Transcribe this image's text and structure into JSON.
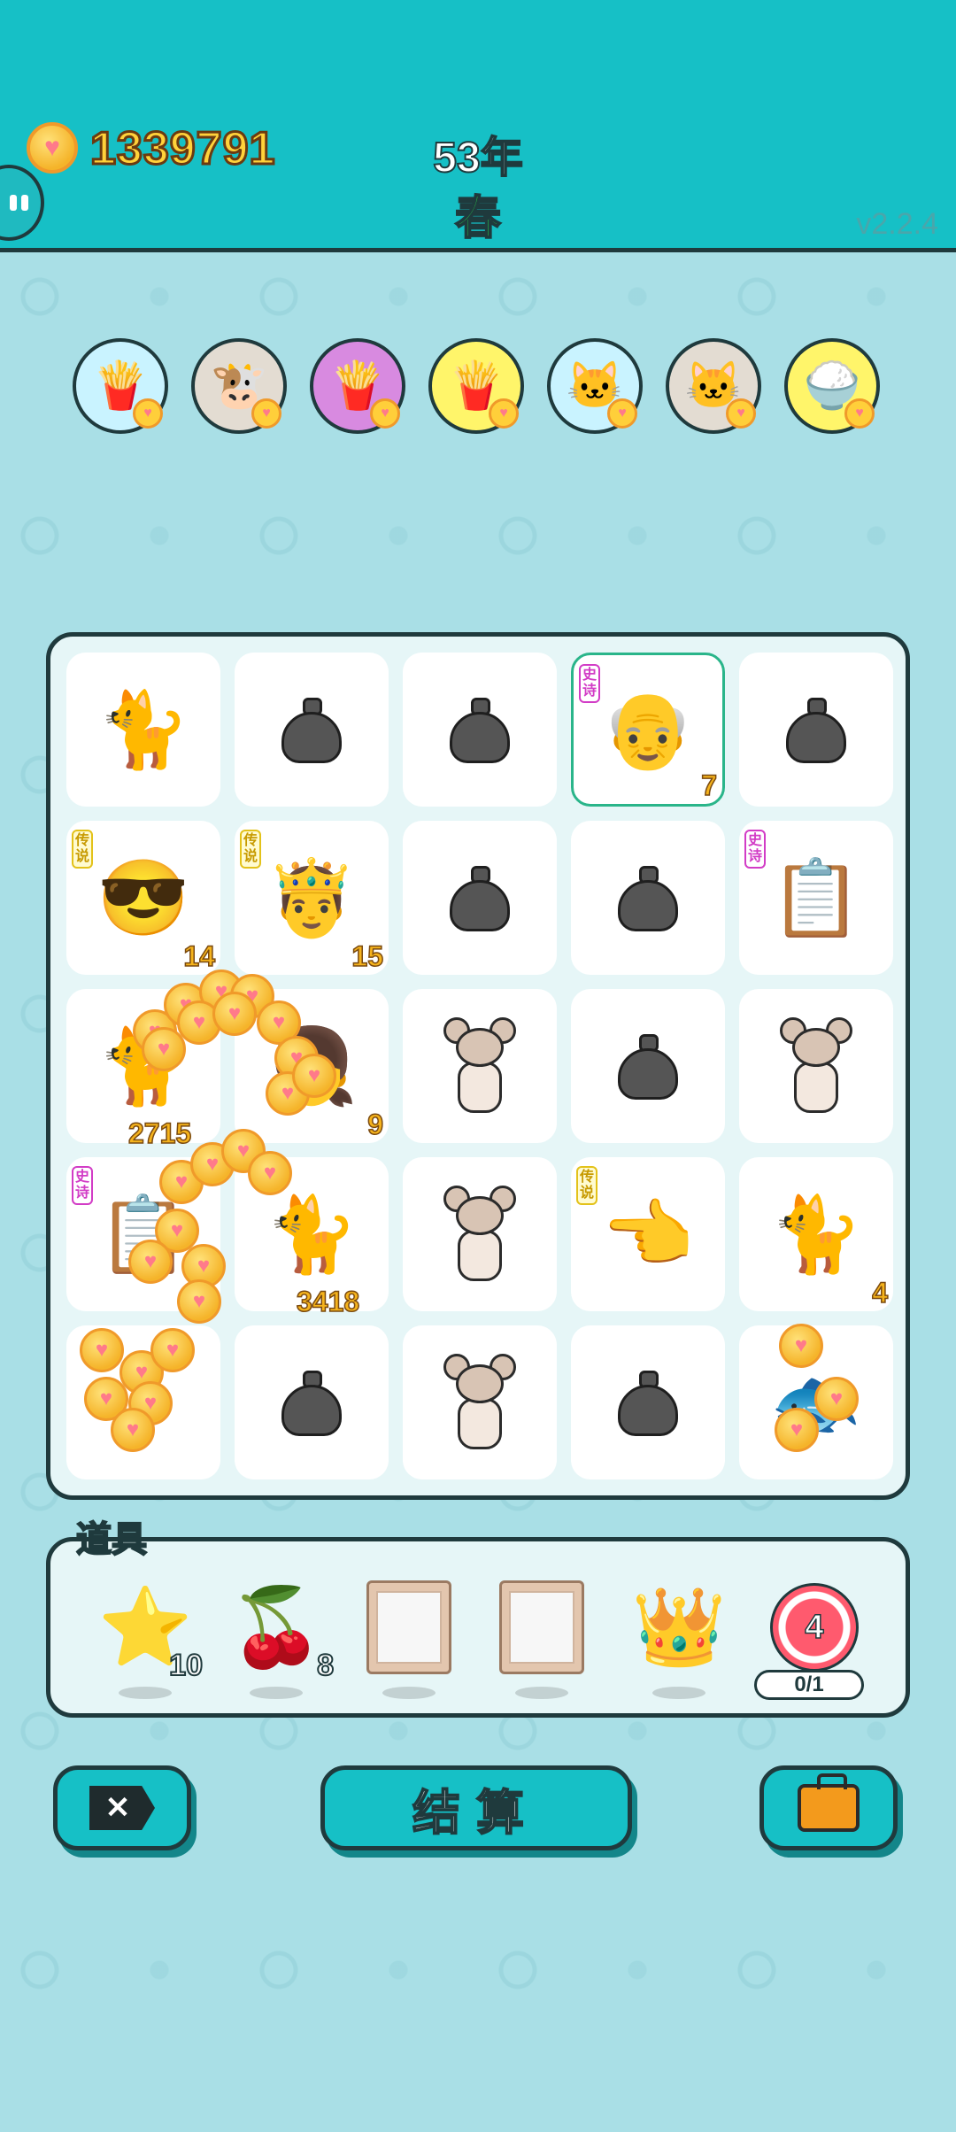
{
  "header": {
    "coins": "1339791",
    "year": "53年",
    "season": "春",
    "version": "v2.2.4"
  },
  "upcoming": [
    {
      "name": "fries",
      "glyph": "🍟",
      "bg": "#c9f3ff"
    },
    {
      "name": "cows",
      "glyph": "🐮",
      "bg": "#e3dcd2"
    },
    {
      "name": "fries",
      "glyph": "🍟",
      "bg": "#d88ae0"
    },
    {
      "name": "fries",
      "glyph": "🍟",
      "bg": "#fff56a"
    },
    {
      "name": "cat",
      "glyph": "🐱",
      "bg": "#c9f3ff"
    },
    {
      "name": "cats",
      "glyph": "🐱",
      "bg": "#e3dcd2"
    },
    {
      "name": "rice",
      "glyph": "🍚",
      "bg": "#fff56a"
    }
  ],
  "board": {
    "tags": {
      "epic": "史诗",
      "legend": "传说"
    },
    "cells": [
      {
        "icon": "cat-icon",
        "glyph": "🐈",
        "tag": "",
        "num": ""
      },
      {
        "icon": "garbage-bag-icon",
        "glyph": "trash",
        "tag": "",
        "num": ""
      },
      {
        "icon": "garbage-bag-icon",
        "glyph": "trash",
        "tag": "",
        "num": ""
      },
      {
        "icon": "bearded-man-icon",
        "glyph": "👴",
        "tag": "epic",
        "num": "7",
        "selected": true
      },
      {
        "icon": "garbage-bag-icon",
        "glyph": "trash",
        "tag": "",
        "num": ""
      },
      {
        "icon": "sunglasses-man-icon",
        "glyph": "😎",
        "tag": "legend",
        "num": "14"
      },
      {
        "icon": "king-icon",
        "glyph": "🤴",
        "tag": "legend",
        "num": "15"
      },
      {
        "icon": "garbage-bag-icon",
        "glyph": "trash",
        "tag": "",
        "num": ""
      },
      {
        "icon": "garbage-bag-icon",
        "glyph": "trash",
        "tag": "",
        "num": ""
      },
      {
        "icon": "ctrl-c-v-icon",
        "glyph": "📋",
        "tag": "epic",
        "num": ""
      },
      {
        "icon": "calico-cat-icon",
        "glyph": "🐈",
        "tag": "",
        "num": "2715"
      },
      {
        "icon": "girl-icon",
        "glyph": "👧",
        "tag": "",
        "num": "9"
      },
      {
        "icon": "mouse-icon",
        "glyph": "rat",
        "tag": "",
        "num": ""
      },
      {
        "icon": "garbage-bag-icon",
        "glyph": "trash",
        "tag": "",
        "num": ""
      },
      {
        "icon": "mouse-icon",
        "glyph": "rat",
        "tag": "",
        "num": ""
      },
      {
        "icon": "ctrl-c-v-icon",
        "glyph": "📋",
        "tag": "epic",
        "num": ""
      },
      {
        "icon": "calico-cat-icon",
        "glyph": "🐈",
        "tag": "",
        "num": "3418"
      },
      {
        "icon": "mouse-icon",
        "glyph": "rat",
        "tag": "",
        "num": ""
      },
      {
        "icon": "pointing-hand-icon",
        "glyph": "👈",
        "tag": "legend",
        "num": ""
      },
      {
        "icon": "cat-icon",
        "glyph": "🐈",
        "tag": "",
        "num": "4"
      },
      {
        "icon": "coins-pile-icon",
        "glyph": "",
        "tag": "",
        "num": ""
      },
      {
        "icon": "garbage-bag-icon",
        "glyph": "trash",
        "tag": "",
        "num": ""
      },
      {
        "icon": "mouse-icon",
        "glyph": "rat",
        "tag": "",
        "num": ""
      },
      {
        "icon": "garbage-bag-icon",
        "glyph": "trash",
        "tag": "",
        "num": ""
      },
      {
        "icon": "fish-icon",
        "glyph": "🐟",
        "tag": "",
        "num": ""
      }
    ]
  },
  "items": {
    "title": "道具",
    "list": [
      {
        "icon": "star-icon",
        "glyph": "⭐",
        "count": "10"
      },
      {
        "icon": "lychee-icon",
        "glyph": "🍒",
        "count": "8"
      },
      {
        "icon": "frame-icon",
        "glyph": "frame",
        "count": ""
      },
      {
        "icon": "frame-icon",
        "glyph": "frame",
        "count": ""
      },
      {
        "icon": "crown-icon",
        "glyph": "👑",
        "count": ""
      },
      {
        "icon": "target-icon",
        "glyph": "target",
        "count": ""
      }
    ],
    "target_value": "4",
    "progress": "0/1"
  },
  "buttons": {
    "exit": "✕",
    "settle": "结算"
  }
}
